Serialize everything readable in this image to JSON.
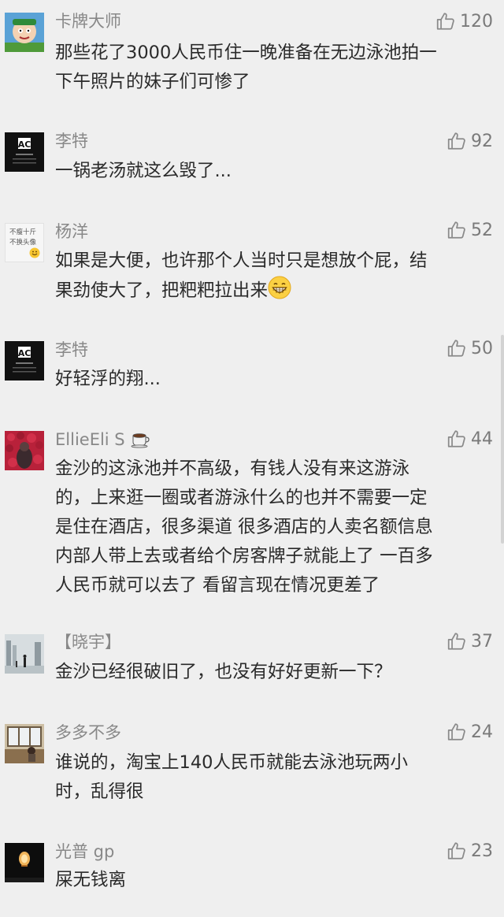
{
  "comments": [
    {
      "name": "卡牌大师",
      "likes": "120",
      "lines": [
        "那些花了3000人民币住一晚准备在无边泳池拍一",
        "下午照片的妹子们可惨了"
      ]
    },
    {
      "name": "李特",
      "likes": "92",
      "lines": [
        "一锅老汤就这么毁了..."
      ]
    },
    {
      "name": "杨洋",
      "likes": "52",
      "lines": [
        "如果是大便，也许那个人当时只是想放个屁，结",
        "果劲使大了，把粑粑拉出来"
      ],
      "avatar_text": [
        "不瘦十斤",
        "不换头像"
      ]
    },
    {
      "name": "李特",
      "likes": "50",
      "lines": [
        "好轻浮的翔..."
      ]
    },
    {
      "name": "EllieEli S",
      "likes": "44",
      "lines": [
        "金沙的这泳池并不高级，有钱人没有来这游泳",
        "的，上来逛一圈或者游泳什么的也并不需要一定",
        "是住在酒店，很多渠道 很多酒店的人卖名额信息",
        "内部人带上去或者给个房客牌子就能上了 一百多",
        "人民币就可以去了 看留言现在情况更差了"
      ]
    },
    {
      "name": "【晓宇】",
      "likes": "37",
      "lines": [
        "金沙已经很破旧了，也没有好好更新一下？"
      ]
    },
    {
      "name": "多多不多",
      "likes": "24",
      "lines": [
        "谁说的，淘宝上140人民币就能去泳池玩两小",
        "时，乱得很"
      ]
    },
    {
      "name": "光普 gp",
      "likes": "23",
      "lines": [
        "屎无钱离"
      ]
    }
  ],
  "icons": {
    "like": "thumbs-up-icon",
    "grin": "grinning-emoji-icon",
    "coffee": "coffee-cup-emoji-icon"
  },
  "colors": {
    "background": "#efefef",
    "name": "#888888",
    "text": "#2a2a2a",
    "icon": "#8a8a8a"
  }
}
